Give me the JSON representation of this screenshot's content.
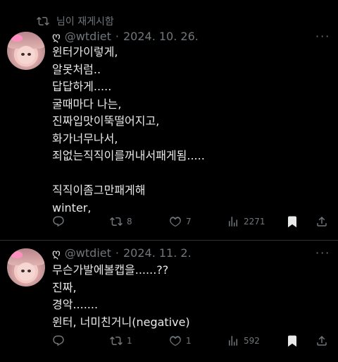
{
  "repost": {
    "label": "님이 재게시함"
  },
  "tweets": [
    {
      "fav_icon": "ღ",
      "handle": "@wtdiet",
      "sep": "·",
      "date": "2024. 10. 26.",
      "lines": [
        "윈터가이렇게,",
        "알못처럼..",
        "답답하게.....",
        "굴때마다 나는,",
        "진짜입맛이뚝떨어지고,",
        "화가너무나서,",
        "죄없는직직이를꺼내서패게됨.....",
        "",
        "직직이좀그만패게해",
        "winter,"
      ],
      "replies": "",
      "reposts": "8",
      "likes": "7",
      "views": "2271"
    },
    {
      "fav_icon": "ღ",
      "handle": "@wtdiet",
      "sep": "·",
      "date": "2024. 11. 2.",
      "lines": [
        "무슨가발에볼캡을......??",
        "진짜,",
        "경악.......",
        "윈터, 너미친거니(negative)"
      ],
      "replies": "",
      "reposts": "1",
      "likes": "1",
      "views": "592"
    }
  ]
}
